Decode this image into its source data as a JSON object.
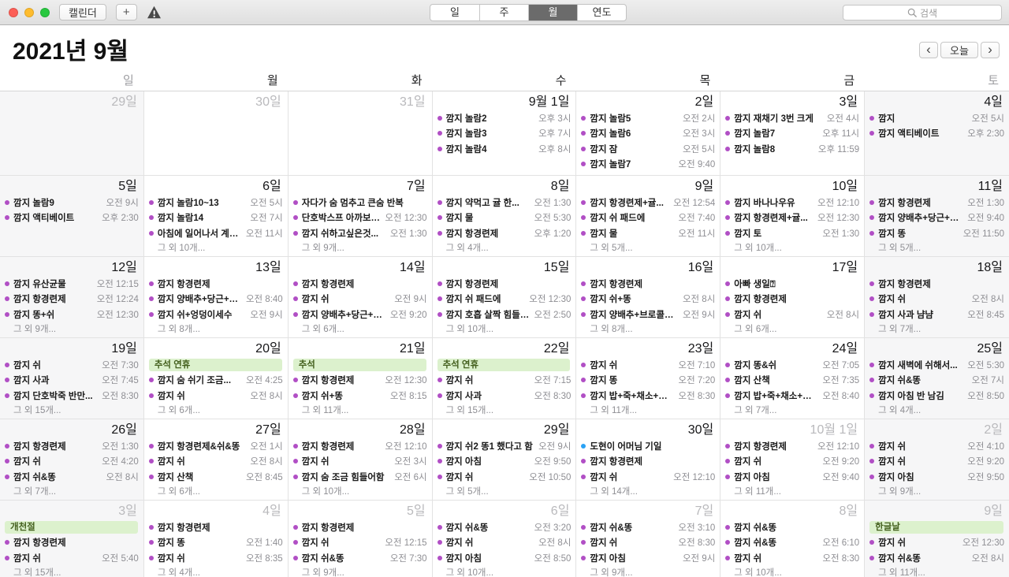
{
  "toolbar": {
    "app_button": "캘린더",
    "add_button": "+",
    "view_tabs": [
      "일",
      "주",
      "월",
      "연도"
    ],
    "selected_tab": "월",
    "search_placeholder": "검색"
  },
  "header": {
    "title": "2021년 9월",
    "prev": "‹",
    "today_button": "오늘",
    "next": "›"
  },
  "weekday_header": [
    "일",
    "월",
    "화",
    "수",
    "목",
    "금",
    "토"
  ],
  "colors": {
    "event_dot": "#b14fc5",
    "blue_dot": "#2aa2f5",
    "holiday_bg": "#dcf1cd",
    "holiday_text": "#44601e"
  },
  "weeks": [
    [
      {
        "day": "29일",
        "dim": true,
        "events": []
      },
      {
        "day": "30일",
        "dim": true,
        "events": []
      },
      {
        "day": "31일",
        "dim": true,
        "events": []
      },
      {
        "day": "9월 1일",
        "events": [
          {
            "title": "깜지 놀람2",
            "time": "오후 3시"
          },
          {
            "title": "깜지 놀람3",
            "time": "오후 7시"
          },
          {
            "title": "깜지 놀람4",
            "time": "오후 8시"
          }
        ]
      },
      {
        "day": "2일",
        "events": [
          {
            "title": "깜지 놀람5",
            "time": "오전 2시"
          },
          {
            "title": "깜지 놀람6",
            "time": "오전 3시"
          },
          {
            "title": "깜지 잠",
            "time": "오전 5시"
          },
          {
            "title": "깜지 놀람7",
            "time": "오전 9:40"
          }
        ]
      },
      {
        "day": "3일",
        "events": [
          {
            "title": "깜지 재채기 3번 크게",
            "time": "오전 4시"
          },
          {
            "title": "깜지 놀람7",
            "time": "오후 11시"
          },
          {
            "title": "깜지 놀람8",
            "time": "오후 11:59"
          }
        ]
      },
      {
        "day": "4일",
        "events": [
          {
            "title": "깜지",
            "time": "오전 5시"
          },
          {
            "title": "깜지 액티베이트",
            "time": "오후 2:30"
          }
        ]
      }
    ],
    [
      {
        "day": "5일",
        "events": [
          {
            "title": "깜지 놀람9",
            "time": "오전 9시"
          },
          {
            "title": "깜지 액티베이트",
            "time": "오후 2:30"
          }
        ]
      },
      {
        "day": "6일",
        "events": [
          {
            "title": "깜지 놀람10~13",
            "time": "오전 5시"
          },
          {
            "title": "깜지 놀람14",
            "time": "오전 7시"
          },
          {
            "title": "아침에 일어나서 계…",
            "time": "오전 11시"
          }
        ],
        "more": "그 외 10개..."
      },
      {
        "day": "7일",
        "events": [
          {
            "title": "자다가 숨 멈추고 큰숨 반복",
            "time": ""
          },
          {
            "title": "단호박스프 아까보…",
            "time": "오전 12:30"
          },
          {
            "title": "깜지 쉬하고싶은것...",
            "time": "오전 1:30"
          }
        ],
        "more": "그 외 9개..."
      },
      {
        "day": "8일",
        "events": [
          {
            "title": "깜지 약먹고 귤 한...",
            "time": "오전 1:30"
          },
          {
            "title": "깜지 물",
            "time": "오전 5:30"
          },
          {
            "title": "깜지 항경련제",
            "time": "오후 1:20"
          }
        ],
        "more": "그 외 4개..."
      },
      {
        "day": "9일",
        "events": [
          {
            "title": "깜지 항경련제+귤...",
            "time": "오전 12:54"
          },
          {
            "title": "깜지 쉬 패드에",
            "time": "오전 7:40"
          },
          {
            "title": "깜지 물",
            "time": "오전 11시"
          }
        ],
        "more": "그 외 5개..."
      },
      {
        "day": "10일",
        "events": [
          {
            "title": "깜지 바나나우유",
            "time": "오전 12:10"
          },
          {
            "title": "깜지 항경련제+귤...",
            "time": "오전 12:30"
          },
          {
            "title": "깜지 토",
            "time": "오전 1:30"
          }
        ],
        "more": "그 외 10개..."
      },
      {
        "day": "11일",
        "events": [
          {
            "title": "깜지 항경련제",
            "time": "오전 1:30"
          },
          {
            "title": "깜지 양배추+당근+…",
            "time": "오전 9:40"
          },
          {
            "title": "깜지 똥",
            "time": "오전 11:50"
          }
        ],
        "more": "그 외 5개..."
      }
    ],
    [
      {
        "day": "12일",
        "events": [
          {
            "title": "깜지 유산균물",
            "time": "오전 12:15"
          },
          {
            "title": "깜지 항경련제",
            "time": "오전 12:24"
          },
          {
            "title": "깜지 똥+쉬",
            "time": "오전 12:30"
          }
        ],
        "more": "그 외 9개..."
      },
      {
        "day": "13일",
        "events": [
          {
            "title": "깜지 항경련제",
            "time": ""
          },
          {
            "title": "깜지 양배추+당근+…",
            "time": "오전 8:40"
          },
          {
            "title": "깜지 쉬+엉덩이세수",
            "time": "오전 9시"
          }
        ],
        "more": "그 외 8개..."
      },
      {
        "day": "14일",
        "events": [
          {
            "title": "깜지 항경련제",
            "time": ""
          },
          {
            "title": "깜지 쉬",
            "time": "오전 9시"
          },
          {
            "title": "깜지 양배추+당근+…",
            "time": "오전 9:20"
          }
        ],
        "more": "그 외 6개..."
      },
      {
        "day": "15일",
        "events": [
          {
            "title": "깜지 항경련제",
            "time": ""
          },
          {
            "title": "깜지 쉬 패드에",
            "time": "오전 12:30"
          },
          {
            "title": "깜지 호흡 살짝 힘들…",
            "time": "오전 2:50"
          }
        ],
        "more": "그 외 10개..."
      },
      {
        "day": "16일",
        "events": [
          {
            "title": "깜지 항경련제",
            "time": ""
          },
          {
            "title": "깜지 쉬+똥",
            "time": "오전 8시"
          },
          {
            "title": "깜지 양배추+브로콜…",
            "time": "오전 9시"
          }
        ],
        "more": "그 외 8개..."
      },
      {
        "day": "17일",
        "events": [
          {
            "title": "아빠 생일⍰",
            "time": ""
          },
          {
            "title": "깜지 항경련제",
            "time": ""
          },
          {
            "title": "깜지 쉬",
            "time": "오전 8시"
          }
        ],
        "more": "그 외 6개..."
      },
      {
        "day": "18일",
        "events": [
          {
            "title": "깜지 항경련제",
            "time": ""
          },
          {
            "title": "깜지 쉬",
            "time": "오전 8시"
          },
          {
            "title": "깜지 사과 냠냠",
            "time": "오전 8:45"
          }
        ],
        "more": "그 외 7개..."
      }
    ],
    [
      {
        "day": "19일",
        "events": [
          {
            "title": "깜지 쉬",
            "time": "오전 7:30"
          },
          {
            "title": "깜지 사과",
            "time": "오전 7:45"
          },
          {
            "title": "깜지 단호박죽 반만...",
            "time": "오전 8:30"
          }
        ],
        "more": "그 외 15개..."
      },
      {
        "day": "20일",
        "banner": "추석 연휴",
        "events": [
          {
            "title": "깜지 숨 쉬기 조금...",
            "time": "오전 4:25"
          },
          {
            "title": "깜지 쉬",
            "time": "오전 8시"
          }
        ],
        "more": "그 외 6개..."
      },
      {
        "day": "21일",
        "banner": "추석",
        "events": [
          {
            "title": "깜지 항경련제",
            "time": "오전 12:30"
          },
          {
            "title": "깜지 쉬+똥",
            "time": "오전 8:15"
          }
        ],
        "more": "그 외 11개..."
      },
      {
        "day": "22일",
        "banner": "추석 연휴",
        "events": [
          {
            "title": "깜지 쉬",
            "time": "오전 7:15"
          },
          {
            "title": "깜지 사과",
            "time": "오전 8:30"
          }
        ],
        "more": "그 외 15개..."
      },
      {
        "day": "23일",
        "events": [
          {
            "title": "깜지 쉬",
            "time": "오전 7:10"
          },
          {
            "title": "깜지 똥",
            "time": "오전 7:20"
          },
          {
            "title": "깜지 밥+죽+채소+…",
            "time": "오전 8:30"
          }
        ],
        "more": "그 외 11개..."
      },
      {
        "day": "24일",
        "events": [
          {
            "title": "깜지 똥&쉬",
            "time": "오전 7:05"
          },
          {
            "title": "깜지 산책",
            "time": "오전 7:35"
          },
          {
            "title": "깜지 밥+죽+채소+…",
            "time": "오전 8:40"
          }
        ],
        "more": "그 외 7개..."
      },
      {
        "day": "25일",
        "events": [
          {
            "title": "깜지 새벽에 쉬해서...",
            "time": "오전 5:30"
          },
          {
            "title": "깜지 쉬&똥",
            "time": "오전 7시"
          },
          {
            "title": "깜지 아침 반 남김",
            "time": "오전 8:50"
          }
        ],
        "more": "그 외 4개..."
      }
    ],
    [
      {
        "day": "26일",
        "events": [
          {
            "title": "깜지 항경련제",
            "time": "오전 1:30"
          },
          {
            "title": "깜지 쉬",
            "time": "오전 4:20"
          },
          {
            "title": "깜지 쉬&똥",
            "time": "오전 8시"
          }
        ],
        "more": "그 외 7개..."
      },
      {
        "day": "27일",
        "events": [
          {
            "title": "깜지 항경련제&쉬&똥",
            "time": "오전 1시"
          },
          {
            "title": "깜지 쉬",
            "time": "오전 8시"
          },
          {
            "title": "깜지 산책",
            "time": "오전 8:45"
          }
        ],
        "more": "그 외 6개..."
      },
      {
        "day": "28일",
        "events": [
          {
            "title": "깜지 항경련제",
            "time": "오전 12:10"
          },
          {
            "title": "깜지 쉬",
            "time": "오전 3시"
          },
          {
            "title": "깜지 숨 조금 힘들어함",
            "time": "오전 6시"
          }
        ],
        "more": "그 외 10개..."
      },
      {
        "day": "29일",
        "events": [
          {
            "title": "깜지 쉬2 똥1 했다고 함",
            "time": "오전 9시"
          },
          {
            "title": "깜지 아침",
            "time": "오전 9:50"
          },
          {
            "title": "깜지 쉬",
            "time": "오전 10:50"
          }
        ],
        "more": "그 외 5개..."
      },
      {
        "day": "30일",
        "events": [
          {
            "title": "도현이 어머님 기일",
            "time": "",
            "dot": "blue"
          },
          {
            "title": "깜지 항경련제",
            "time": ""
          },
          {
            "title": "깜지 쉬",
            "time": "오전 12:10"
          }
        ],
        "more": "그 외 14개..."
      },
      {
        "day": "10월 1일",
        "dim": true,
        "events": [
          {
            "title": "깜지 항경련제",
            "time": "오전 12:10"
          },
          {
            "title": "깜지 쉬",
            "time": "오전 9:20"
          },
          {
            "title": "깜지 아침",
            "time": "오전 9:40"
          }
        ],
        "more": "그 외 11개..."
      },
      {
        "day": "2일",
        "dim": true,
        "events": [
          {
            "title": "깜지 쉬",
            "time": "오전 4:10"
          },
          {
            "title": "깜지 쉬",
            "time": "오전 9:20"
          },
          {
            "title": "깜지 아침",
            "time": "오전 9:50"
          }
        ],
        "more": "그 외 9개..."
      }
    ],
    [
      {
        "day": "3일",
        "dim": true,
        "banner": "개천절",
        "events": [
          {
            "title": "깜지 항경련제",
            "time": ""
          },
          {
            "title": "깜지 쉬",
            "time": "오전 5:40"
          }
        ],
        "more": "그 외 15개..."
      },
      {
        "day": "4일",
        "dim": true,
        "events": [
          {
            "title": "깜지 항경련제",
            "time": ""
          },
          {
            "title": "깜지 똥",
            "time": "오전 1:40"
          },
          {
            "title": "깜지 쉬",
            "time": "오전 8:35"
          }
        ],
        "more": "그 외 4개..."
      },
      {
        "day": "5일",
        "dim": true,
        "events": [
          {
            "title": "깜지 항경련제",
            "time": ""
          },
          {
            "title": "깜지 쉬",
            "time": "오전 12:15"
          },
          {
            "title": "깜지 쉬&똥",
            "time": "오전 7:30"
          }
        ],
        "more": "그 외 9개..."
      },
      {
        "day": "6일",
        "dim": true,
        "events": [
          {
            "title": "깜지 쉬&똥",
            "time": "오전 3:20"
          },
          {
            "title": "깜지 쉬",
            "time": "오전 8시"
          },
          {
            "title": "깜지 아침",
            "time": "오전 8:50"
          }
        ],
        "more": "그 외 10개..."
      },
      {
        "day": "7일",
        "dim": true,
        "events": [
          {
            "title": "깜지 쉬&똥",
            "time": "오전 3:10"
          },
          {
            "title": "깜지 쉬",
            "time": "오전 8:30"
          },
          {
            "title": "깜지 아침",
            "time": "오전 9시"
          }
        ],
        "more": "그 외 9개..."
      },
      {
        "day": "8일",
        "dim": true,
        "events": [
          {
            "title": "깜지 쉬&똥",
            "time": ""
          },
          {
            "title": "깜지 쉬&똥",
            "time": "오전 6:10"
          },
          {
            "title": "깜지 쉬",
            "time": "오전 8:30"
          }
        ],
        "more": "그 외 10개..."
      },
      {
        "day": "9일",
        "dim": true,
        "banner": "한글날",
        "events": [
          {
            "title": "깜지 쉬",
            "time": "오전 12:30"
          },
          {
            "title": "깜지 쉬&똥",
            "time": "오전 8시"
          }
        ],
        "more": "그 외 11개..."
      }
    ]
  ]
}
